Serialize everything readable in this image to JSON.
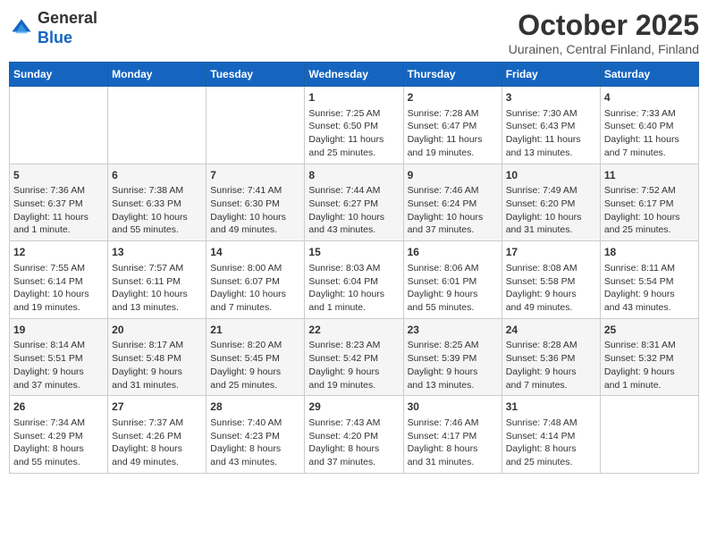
{
  "header": {
    "logo_general": "General",
    "logo_blue": "Blue",
    "month_title": "October 2025",
    "location": "Uurainen, Central Finland, Finland"
  },
  "days_of_week": [
    "Sunday",
    "Monday",
    "Tuesday",
    "Wednesday",
    "Thursday",
    "Friday",
    "Saturday"
  ],
  "weeks": [
    [
      {
        "day": "",
        "info": ""
      },
      {
        "day": "",
        "info": ""
      },
      {
        "day": "",
        "info": ""
      },
      {
        "day": "1",
        "info": "Sunrise: 7:25 AM\nSunset: 6:50 PM\nDaylight: 11 hours\nand 25 minutes."
      },
      {
        "day": "2",
        "info": "Sunrise: 7:28 AM\nSunset: 6:47 PM\nDaylight: 11 hours\nand 19 minutes."
      },
      {
        "day": "3",
        "info": "Sunrise: 7:30 AM\nSunset: 6:43 PM\nDaylight: 11 hours\nand 13 minutes."
      },
      {
        "day": "4",
        "info": "Sunrise: 7:33 AM\nSunset: 6:40 PM\nDaylight: 11 hours\nand 7 minutes."
      }
    ],
    [
      {
        "day": "5",
        "info": "Sunrise: 7:36 AM\nSunset: 6:37 PM\nDaylight: 11 hours\nand 1 minute."
      },
      {
        "day": "6",
        "info": "Sunrise: 7:38 AM\nSunset: 6:33 PM\nDaylight: 10 hours\nand 55 minutes."
      },
      {
        "day": "7",
        "info": "Sunrise: 7:41 AM\nSunset: 6:30 PM\nDaylight: 10 hours\nand 49 minutes."
      },
      {
        "day": "8",
        "info": "Sunrise: 7:44 AM\nSunset: 6:27 PM\nDaylight: 10 hours\nand 43 minutes."
      },
      {
        "day": "9",
        "info": "Sunrise: 7:46 AM\nSunset: 6:24 PM\nDaylight: 10 hours\nand 37 minutes."
      },
      {
        "day": "10",
        "info": "Sunrise: 7:49 AM\nSunset: 6:20 PM\nDaylight: 10 hours\nand 31 minutes."
      },
      {
        "day": "11",
        "info": "Sunrise: 7:52 AM\nSunset: 6:17 PM\nDaylight: 10 hours\nand 25 minutes."
      }
    ],
    [
      {
        "day": "12",
        "info": "Sunrise: 7:55 AM\nSunset: 6:14 PM\nDaylight: 10 hours\nand 19 minutes."
      },
      {
        "day": "13",
        "info": "Sunrise: 7:57 AM\nSunset: 6:11 PM\nDaylight: 10 hours\nand 13 minutes."
      },
      {
        "day": "14",
        "info": "Sunrise: 8:00 AM\nSunset: 6:07 PM\nDaylight: 10 hours\nand 7 minutes."
      },
      {
        "day": "15",
        "info": "Sunrise: 8:03 AM\nSunset: 6:04 PM\nDaylight: 10 hours\nand 1 minute."
      },
      {
        "day": "16",
        "info": "Sunrise: 8:06 AM\nSunset: 6:01 PM\nDaylight: 9 hours\nand 55 minutes."
      },
      {
        "day": "17",
        "info": "Sunrise: 8:08 AM\nSunset: 5:58 PM\nDaylight: 9 hours\nand 49 minutes."
      },
      {
        "day": "18",
        "info": "Sunrise: 8:11 AM\nSunset: 5:54 PM\nDaylight: 9 hours\nand 43 minutes."
      }
    ],
    [
      {
        "day": "19",
        "info": "Sunrise: 8:14 AM\nSunset: 5:51 PM\nDaylight: 9 hours\nand 37 minutes."
      },
      {
        "day": "20",
        "info": "Sunrise: 8:17 AM\nSunset: 5:48 PM\nDaylight: 9 hours\nand 31 minutes."
      },
      {
        "day": "21",
        "info": "Sunrise: 8:20 AM\nSunset: 5:45 PM\nDaylight: 9 hours\nand 25 minutes."
      },
      {
        "day": "22",
        "info": "Sunrise: 8:23 AM\nSunset: 5:42 PM\nDaylight: 9 hours\nand 19 minutes."
      },
      {
        "day": "23",
        "info": "Sunrise: 8:25 AM\nSunset: 5:39 PM\nDaylight: 9 hours\nand 13 minutes."
      },
      {
        "day": "24",
        "info": "Sunrise: 8:28 AM\nSunset: 5:36 PM\nDaylight: 9 hours\nand 7 minutes."
      },
      {
        "day": "25",
        "info": "Sunrise: 8:31 AM\nSunset: 5:32 PM\nDaylight: 9 hours\nand 1 minute."
      }
    ],
    [
      {
        "day": "26",
        "info": "Sunrise: 7:34 AM\nSunset: 4:29 PM\nDaylight: 8 hours\nand 55 minutes."
      },
      {
        "day": "27",
        "info": "Sunrise: 7:37 AM\nSunset: 4:26 PM\nDaylight: 8 hours\nand 49 minutes."
      },
      {
        "day": "28",
        "info": "Sunrise: 7:40 AM\nSunset: 4:23 PM\nDaylight: 8 hours\nand 43 minutes."
      },
      {
        "day": "29",
        "info": "Sunrise: 7:43 AM\nSunset: 4:20 PM\nDaylight: 8 hours\nand 37 minutes."
      },
      {
        "day": "30",
        "info": "Sunrise: 7:46 AM\nSunset: 4:17 PM\nDaylight: 8 hours\nand 31 minutes."
      },
      {
        "day": "31",
        "info": "Sunrise: 7:48 AM\nSunset: 4:14 PM\nDaylight: 8 hours\nand 25 minutes."
      },
      {
        "day": "",
        "info": ""
      }
    ]
  ]
}
